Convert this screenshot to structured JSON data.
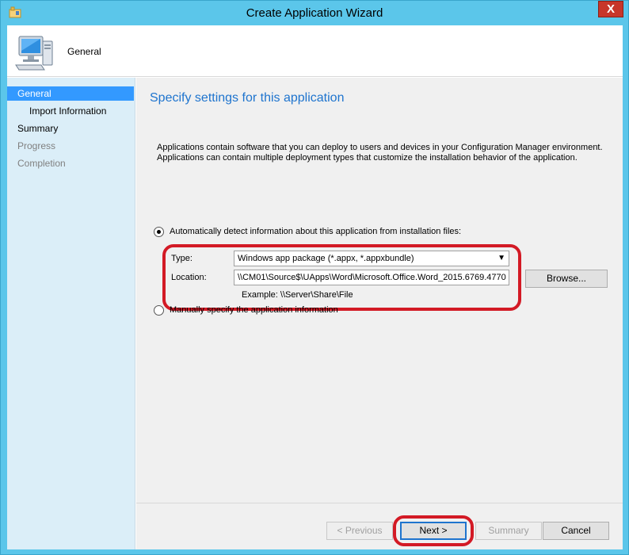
{
  "window": {
    "title": "Create Application Wizard",
    "close_label": "X"
  },
  "header": {
    "page_name": "General"
  },
  "nav": {
    "items": [
      {
        "label": "General",
        "state": "selected"
      },
      {
        "label": "Import Information",
        "state": "normal"
      },
      {
        "label": "Summary",
        "state": "normal"
      },
      {
        "label": "Progress",
        "state": "disabled"
      },
      {
        "label": "Completion",
        "state": "disabled"
      }
    ]
  },
  "content": {
    "title": "Specify settings for this application",
    "description_line1": "Applications contain software that you can deploy to users and devices in your Configuration Manager environment.",
    "description_line2": "Applications can contain multiple deployment types that customize the installation behavior of the application.",
    "auto_option_label": "Automatically detect information about this application from installation files:",
    "type_label": "Type:",
    "type_value": "Windows app package (*.appx, *.appxbundle)",
    "location_label": "Location:",
    "location_value": "\\\\CM01\\Source$\\UApps\\Word\\Microsoft.Office.Word_2015.6769.4770",
    "browse_label": "Browse...",
    "example_text": "Example: \\\\Server\\Share\\File",
    "manual_option_label": "Manually specify the application information"
  },
  "footer": {
    "previous_label": "< Previous",
    "next_label": "Next >",
    "summary_label": "Summary",
    "cancel_label": "Cancel"
  },
  "colors": {
    "title_bar": "#5bc6ea",
    "nav_background": "#dbeef8",
    "selected_nav": "#3399ff",
    "content_title": "#1e74ce",
    "highlight_annotation": "#d31a25",
    "close_button": "#c7362a"
  }
}
